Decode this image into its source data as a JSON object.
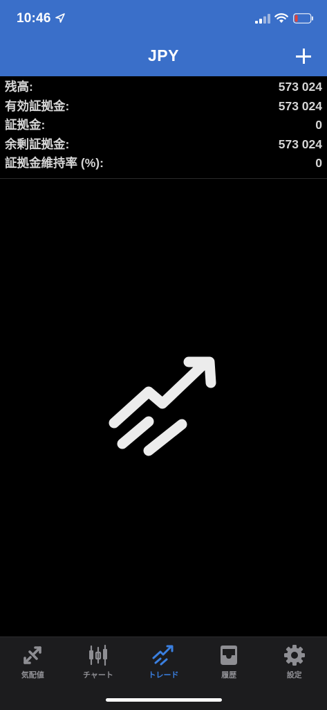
{
  "status_bar": {
    "time": "10:46",
    "location_icon": "location-arrow-icon",
    "signal_icon": "cellular-signal-icon",
    "wifi_icon": "wifi-icon",
    "battery_icon": "battery-low-icon",
    "battery_color": "#e0433a"
  },
  "header": {
    "title": "JPY",
    "add_icon": "plus-icon",
    "background": "#3a6fc9"
  },
  "summary": {
    "rows": [
      {
        "label": "残高:",
        "value": "573 024"
      },
      {
        "label": "有効証拠金:",
        "value": "573 024"
      },
      {
        "label": "証拠金:",
        "value": "0"
      },
      {
        "label": "余剰証拠金:",
        "value": "573 024"
      },
      {
        "label": "証拠金維持率 (%):",
        "value": "0"
      }
    ]
  },
  "empty_state": {
    "icon": "trade-trend-icon"
  },
  "tabbar": {
    "active_color": "#3a7fe0",
    "inactive_color": "#8e8e93",
    "tabs": [
      {
        "label": "気配値",
        "icon": "quotes-arrows-icon",
        "active": false
      },
      {
        "label": "チャート",
        "icon": "candlestick-icon",
        "active": false
      },
      {
        "label": "トレード",
        "icon": "trade-trend-icon",
        "active": true
      },
      {
        "label": "履歴",
        "icon": "inbox-tray-icon",
        "active": false
      },
      {
        "label": "設定",
        "icon": "gear-icon",
        "active": false
      }
    ]
  }
}
